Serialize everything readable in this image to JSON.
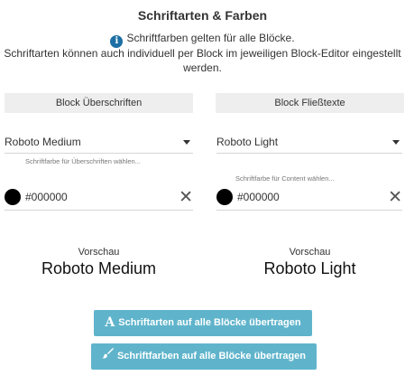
{
  "header": {
    "title": "Schriftarten & Farben",
    "info_text": "Schriftfarben gelten für alle Blöcke.",
    "info_sub": "Schriftarten können auch individuell per Block im jeweiligen Block-Editor eingestellt werden."
  },
  "left": {
    "header_label": "Block Überschriften",
    "font_value": "Roboto Medium",
    "color_hint": "Schriftfarbe für Überschriften wählen...",
    "color_value": "#000000",
    "preview_label": "Vorschau",
    "preview_text": "Roboto Medium"
  },
  "right": {
    "header_label": "Block Fließtexte",
    "font_value": "Roboto Light",
    "color_hint": "Schriftfarbe für Content wählen...",
    "color_value": "#000000",
    "preview_label": "Vorschau",
    "preview_text": "Roboto Light"
  },
  "actions": {
    "apply_fonts_label": "Schriftarten auf alle Blöcke übertragen",
    "apply_colors_label": "Schriftfarben auf alle Blöcke übertragen"
  },
  "icons": {
    "info": "info-icon",
    "dropdown": "caret-down-icon",
    "clear": "close-icon",
    "fonts": "font-icon",
    "colors": "paintbrush-icon"
  },
  "colors": {
    "button_bg": "#5fb4cb",
    "info_icon": "#1d6fa5",
    "header_bg": "#eeeeee",
    "swatch": "#000000"
  }
}
